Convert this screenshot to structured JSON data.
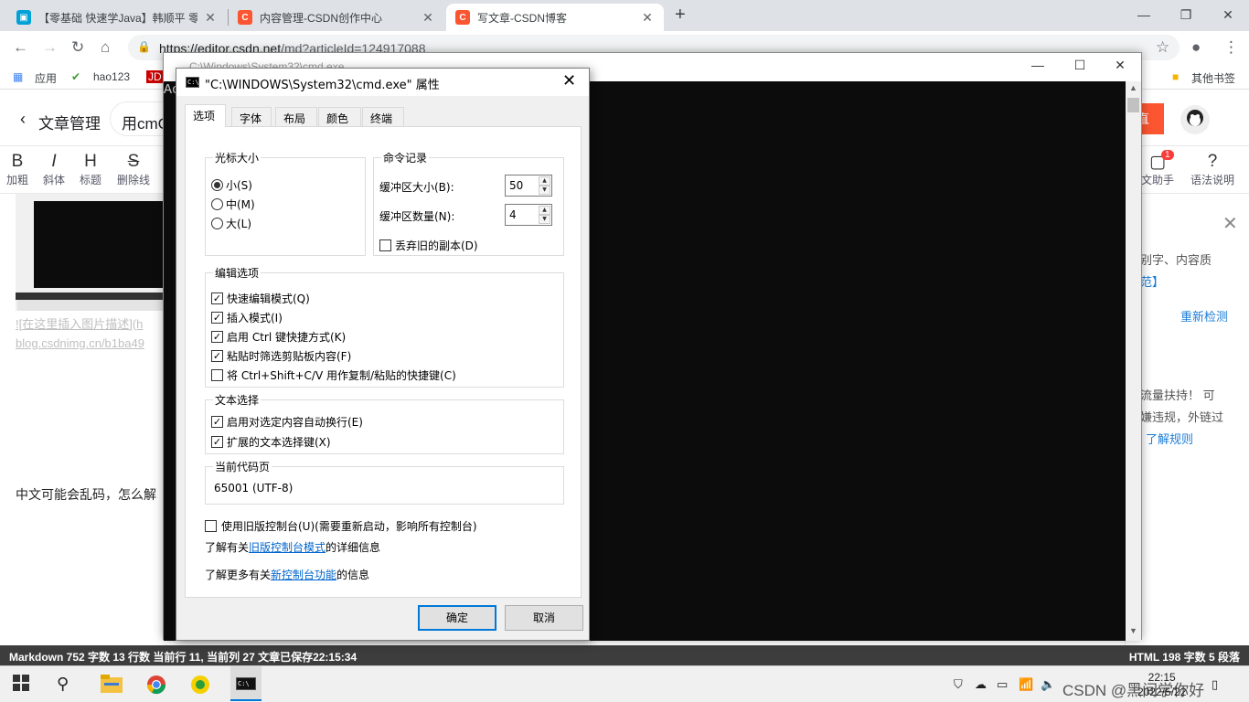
{
  "browser": {
    "tabs": [
      {
        "title": "【零基础 快速学Java】韩顺平 零",
        "active": false
      },
      {
        "title": "内容管理-CSDN创作中心",
        "active": false
      },
      {
        "title": "写文章-CSDN博客",
        "active": true
      }
    ],
    "url_host": "https://editor.csdn.net",
    "url_path": "/md?articleId=124917088",
    "bookmarks": [
      "应用",
      "hao123",
      "JD"
    ],
    "other_bookmarks": "其他书签"
  },
  "page": {
    "header_back_title": "文章管理",
    "title_input": "用cmC:",
    "publish_fragment": "直",
    "tools": [
      {
        "glyph": "B",
        "label": "加粗"
      },
      {
        "glyph": "I",
        "label": "斜体"
      },
      {
        "glyph": "H",
        "label": "标题"
      },
      {
        "glyph": "S",
        "label": "删除线"
      }
    ],
    "tools_right": [
      {
        "label": "文助手",
        "badge": "1"
      },
      {
        "label": "语法说明"
      }
    ],
    "editor_lines": [
      "![在这里插入图片描述](h",
      "blog.csdnimg.cn/b1ba49"
    ],
    "editor_text": "中文可能会乱码，怎么解",
    "side": {
      "t1": "别字、内容质",
      "t2": "范】",
      "recheck": "重新检测",
      "t3": "流量扶持！ 可",
      "t4": "嫌违规，外链过",
      "rules": "了解规则"
    },
    "status_left": "Markdown  752 字数  13 行数  当前行 11, 当前列 27  文章已保存22:15:34",
    "status_right": "HTML  198 字数  5 段落"
  },
  "cmd": {
    "title": "C:\\Windows\\System32\\cmd.exe",
    "console_text": "Ac"
  },
  "dialog": {
    "title": "\"C:\\WINDOWS\\System32\\cmd.exe\" 属性",
    "tabs": [
      "选项",
      "字体",
      "布局",
      "颜色",
      "终端"
    ],
    "cursor_group": "光标大小",
    "cursor_small": "小(S)",
    "cursor_medium": "中(M)",
    "cursor_large": "大(L)",
    "history_group": "命令记录",
    "buffer_size_label": "缓冲区大小(B):",
    "buffer_size": "50",
    "buffer_count_label": "缓冲区数量(N):",
    "buffer_count": "4",
    "discard_old": "丢弃旧的副本(D)",
    "edit_group": "编辑选项",
    "edit_options": [
      {
        "label": "快速编辑模式(Q)",
        "checked": true
      },
      {
        "label": "插入模式(I)",
        "checked": true
      },
      {
        "label": "启用 Ctrl 键快捷方式(K)",
        "checked": true
      },
      {
        "label": "粘贴时筛选剪贴板内容(F)",
        "checked": true
      },
      {
        "label": "将 Ctrl+Shift+C/V 用作复制/粘贴的快捷键(C)",
        "checked": false
      }
    ],
    "text_group": "文本选择",
    "text_options": [
      {
        "label": "启用对选定内容自动换行(E)",
        "checked": true
      },
      {
        "label": "扩展的文本选择键(X)",
        "checked": true
      }
    ],
    "codepage_group": "当前代码页",
    "codepage": "65001 (UTF-8)",
    "legacy_console": "使用旧版控制台(U)(需要重新启动，影响所有控制台)",
    "learn_legacy_pre": "了解有关",
    "learn_legacy_link": "旧版控制台模式",
    "learn_legacy_post": "的详细信息",
    "learn_new_pre": "了解更多有关",
    "learn_new_link": "新控制台功能",
    "learn_new_post": "的信息",
    "ok": "确定",
    "cancel": "取消"
  },
  "taskbar": {
    "time": "22:15",
    "date": "2022/5/22",
    "tray_text": "CSDN @黑间学你好"
  }
}
